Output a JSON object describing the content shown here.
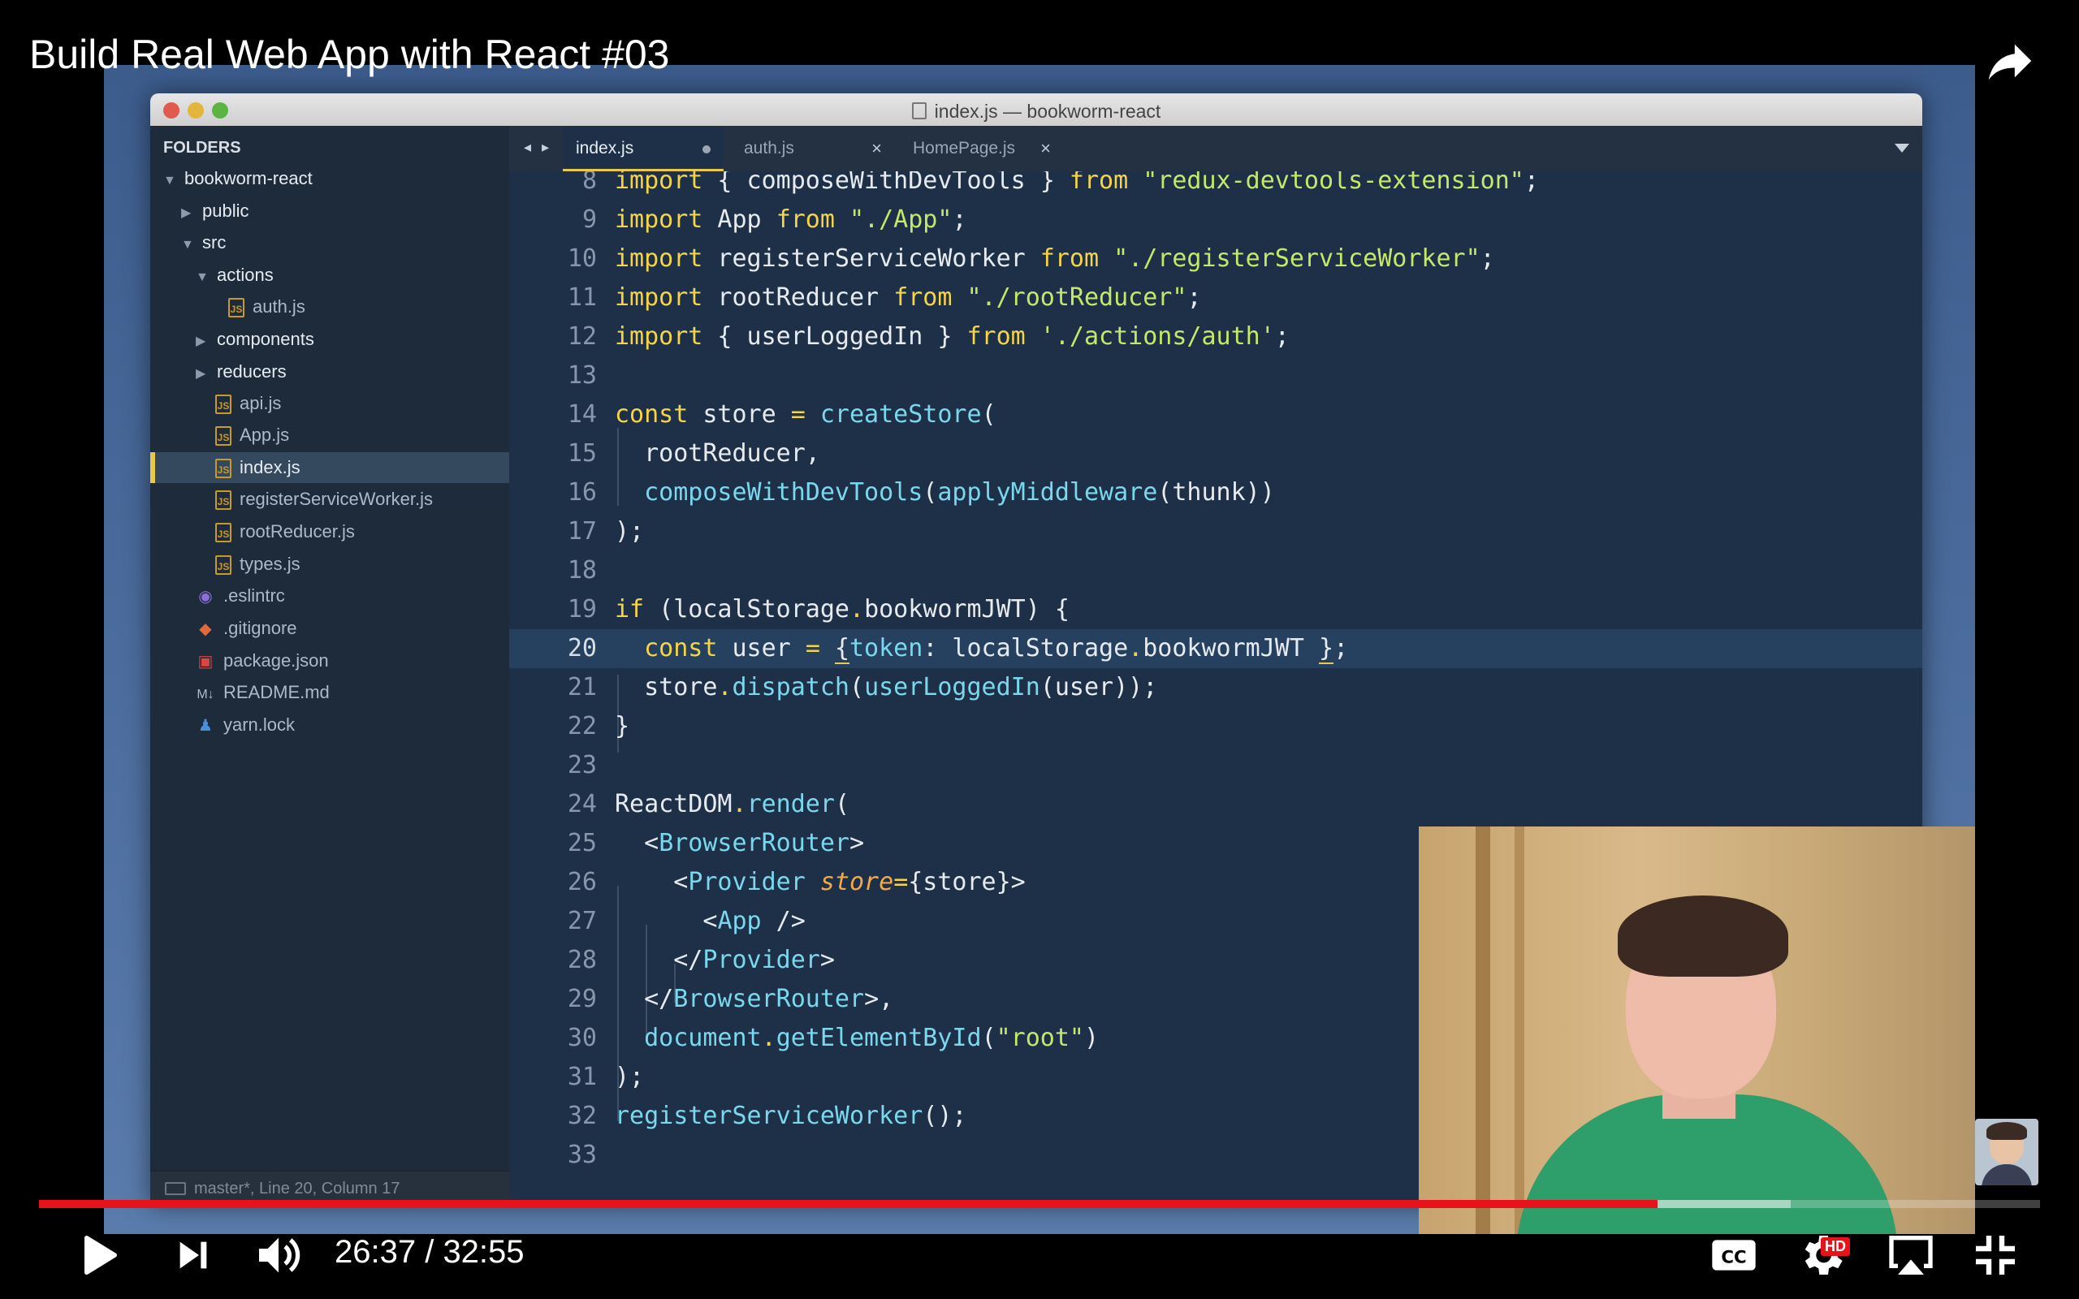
{
  "video": {
    "title": "Build Real Web App with React #03",
    "time": "26:37 / 32:55",
    "progress_fraction": 0.8087,
    "buffered_fraction": 0.8755,
    "hd_badge": "HD"
  },
  "editor": {
    "window_title": "index.js — bookworm-react",
    "sidebar_header": "FOLDERS",
    "tree": [
      {
        "label": "bookworm-react",
        "kind": "folder-open"
      },
      {
        "label": "public",
        "kind": "folder-closed"
      },
      {
        "label": "src",
        "kind": "folder-open"
      },
      {
        "label": "actions",
        "kind": "folder-open"
      },
      {
        "label": "auth.js",
        "kind": "js"
      },
      {
        "label": "components",
        "kind": "folder-closed"
      },
      {
        "label": "reducers",
        "kind": "folder-closed"
      },
      {
        "label": "api.js",
        "kind": "js"
      },
      {
        "label": "App.js",
        "kind": "js"
      },
      {
        "label": "index.js",
        "kind": "js",
        "selected": true
      },
      {
        "label": "registerServiceWorker.js",
        "kind": "js"
      },
      {
        "label": "rootReducer.js",
        "kind": "js"
      },
      {
        "label": "types.js",
        "kind": "js"
      },
      {
        "label": ".eslintrc",
        "kind": "config"
      },
      {
        "label": ".gitignore",
        "kind": "git"
      },
      {
        "label": "package.json",
        "kind": "package"
      },
      {
        "label": "README.md",
        "kind": "markdown"
      },
      {
        "label": "yarn.lock",
        "kind": "lock"
      }
    ],
    "tabs": [
      {
        "label": "index.js",
        "active": true,
        "modified": true
      },
      {
        "label": "auth.js",
        "active": false
      },
      {
        "label": "HomePage.js",
        "active": false
      }
    ],
    "tab_nav": "◂ ▸",
    "status": "master*, Line 20, Column 17",
    "line_numbers": [
      "8",
      "9",
      "10",
      "11",
      "12",
      "13",
      "14",
      "15",
      "16",
      "17",
      "18",
      "19",
      "20",
      "21",
      "22",
      "23",
      "24",
      "25",
      "26",
      "27",
      "28",
      "29",
      "30",
      "31",
      "32",
      "33"
    ],
    "current_line": "20",
    "code": [
      "import { composeWithDevTools } from \"redux-devtools-extension\";",
      "import App from \"./App\";",
      "import registerServiceWorker from \"./registerServiceWorker\";",
      "import rootReducer from \"./rootReducer\";",
      "import { userLoggedIn } from './actions/auth';",
      "",
      "const store = createStore(",
      "  rootReducer,",
      "  composeWithDevTools(applyMiddleware(thunk))",
      ");",
      "",
      "if (localStorage.bookwormJWT) {",
      "  const user = { token: localStorage.bookwormJWT };",
      "  store.dispatch(userLoggedIn(user));",
      "}",
      "",
      "ReactDOM.render(",
      "  <BrowserRouter>",
      "    <Provider store={store}>",
      "      <App />",
      "    </Provider>",
      "  </BrowserRouter>,",
      "  document.getElementById(\"root\")",
      ");",
      "registerServiceWorker();",
      ""
    ]
  },
  "icons": {
    "share": "share-arrow-icon",
    "play": "play-icon",
    "next": "next-icon",
    "volume": "volume-icon",
    "captions": "cc-icon",
    "settings": "gear-icon",
    "airplay": "airplay-icon",
    "fullscreen_exit": "exit-fullscreen-icon"
  },
  "colors": {
    "progress": "#e8121a",
    "keyword": "#f5d547",
    "string": "#c5e86a",
    "function": "#7ad7ee",
    "selection_accent": "#e8c94a"
  }
}
